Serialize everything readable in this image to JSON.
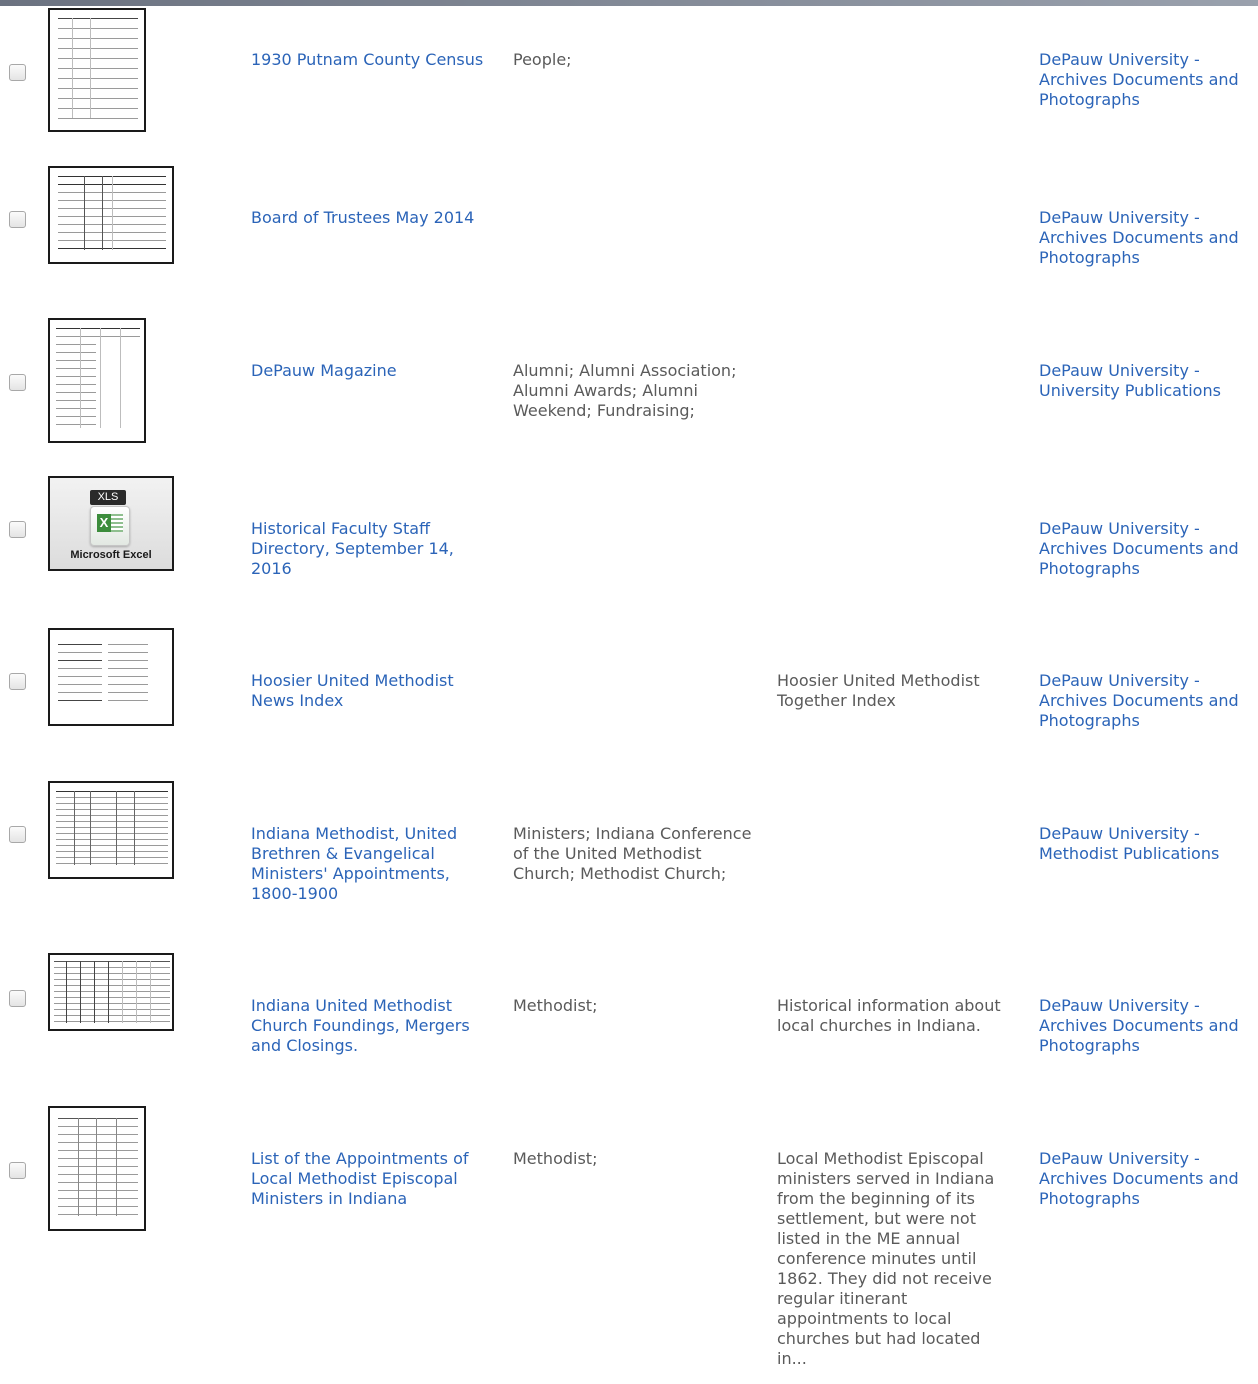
{
  "results": [
    {
      "title": "1930 Putnam County Census",
      "subjects": "People;",
      "description": "",
      "collection": "DePauw University - Archives Documents and Photographs",
      "thumbnail_icon": "document-thumbnail-icon"
    },
    {
      "title": "Board of Trustees May 2014",
      "subjects": "",
      "description": "",
      "collection": "DePauw University - Archives Documents and Photographs",
      "thumbnail_icon": "document-thumbnail-icon"
    },
    {
      "title": "DePauw Magazine",
      "subjects": "Alumni; Alumni Association; Alumni Awards; Alumni Weekend; Fundraising;",
      "description": "",
      "collection": "DePauw University - University Publications",
      "thumbnail_icon": "document-thumbnail-icon"
    },
    {
      "title": "Historical Faculty Staff Directory, September 14, 2016",
      "subjects": "",
      "description": "",
      "collection": "DePauw University - Archives Documents and Photographs",
      "thumbnail_icon": "excel-file-icon",
      "thumbnail_badge": "XLS",
      "thumbnail_label": "Microsoft Excel"
    },
    {
      "title": "Hoosier United Methodist News Index",
      "subjects": "",
      "description": "Hoosier United Methodist Together Index",
      "collection": "DePauw University - Archives Documents and Photographs",
      "thumbnail_icon": "document-thumbnail-icon"
    },
    {
      "title": "Indiana Methodist, United Brethren & Evangelical Ministers' Appointments, 1800-1900",
      "subjects": "Ministers; Indiana Conference of the United Methodist Church; Methodist Church;",
      "description": "",
      "collection": "DePauw University - Methodist Publications",
      "thumbnail_icon": "spreadsheet-thumbnail-icon"
    },
    {
      "title": "Indiana United Methodist Church Foundings, Mergers and Closings.",
      "subjects": "Methodist;",
      "description": "Historical information about local churches in Indiana.",
      "collection": "DePauw University - Archives Documents and Photographs",
      "thumbnail_icon": "spreadsheet-thumbnail-icon"
    },
    {
      "title": "List of the Appointments of Local Methodist Episcopal Ministers in Indiana",
      "subjects": "Methodist;",
      "description": "Local Methodist Episcopal ministers served in Indiana from the beginning of its settlement, but were not listed in the ME annual conference minutes until 1862. They did not receive regular itinerant appointments to local churches but had located in...",
      "collection": "DePauw University - Archives Documents and Photographs",
      "thumbnail_icon": "document-thumbnail-icon"
    }
  ]
}
